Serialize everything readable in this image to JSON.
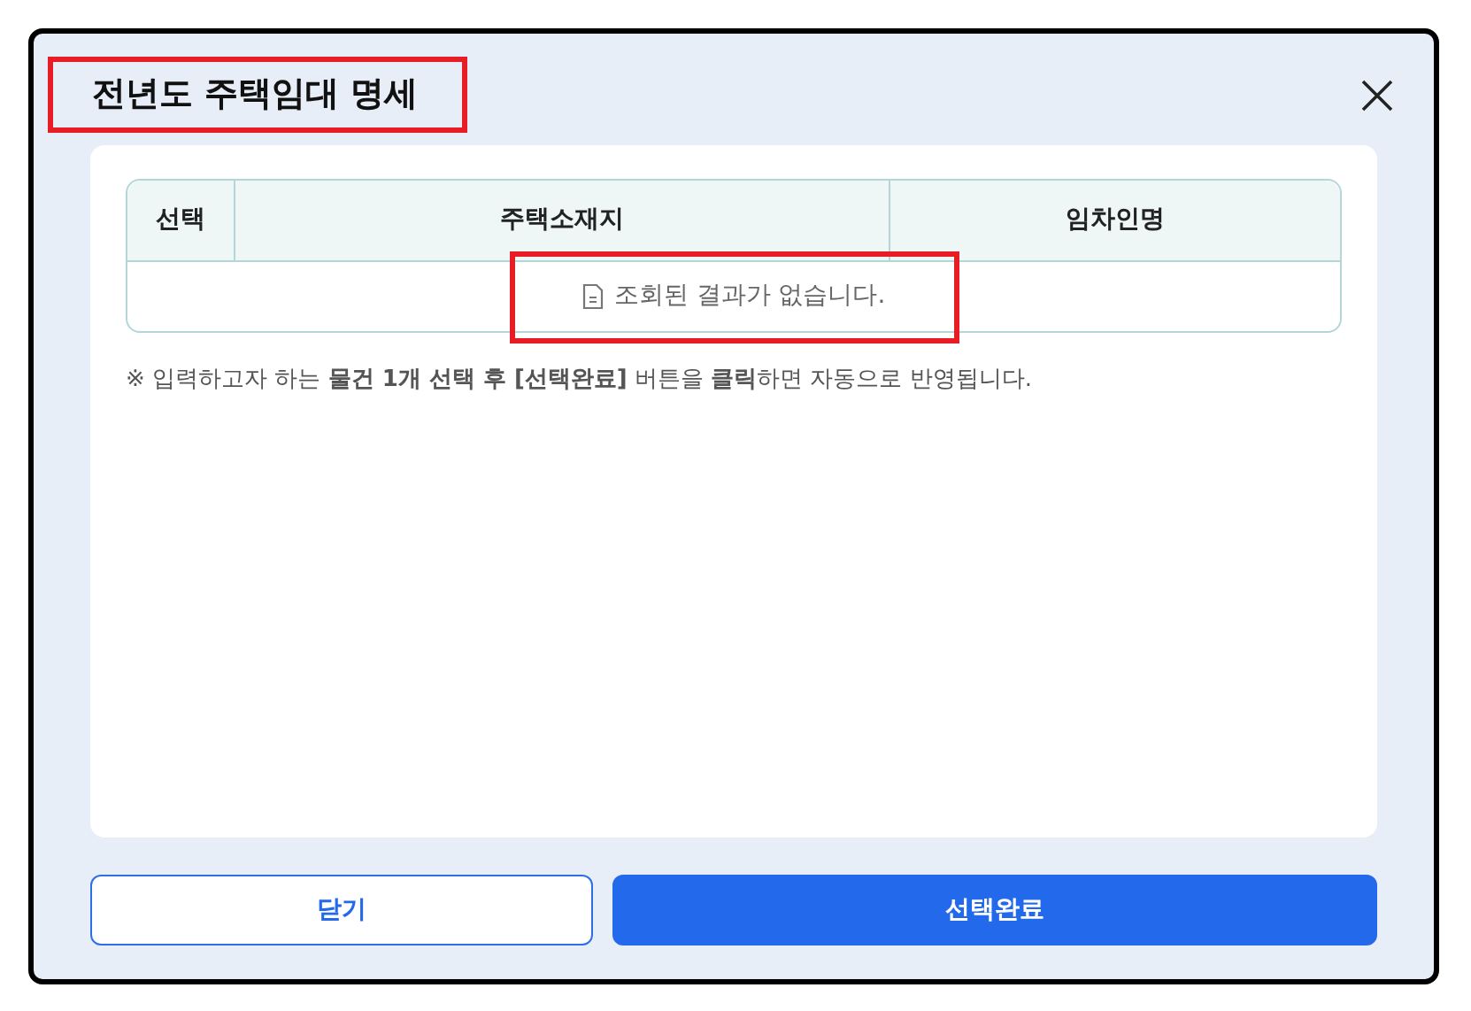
{
  "dialog": {
    "title": "전년도 주택임대 명세",
    "title_highlighted": true
  },
  "table": {
    "columns": [
      "선택",
      "주택소재지",
      "임차인명"
    ],
    "empty_message": "조회된 결과가 없습니다.",
    "empty_highlighted": true
  },
  "note": "※ 입력하고자 하는 **물건 1개 선택 후 [선택완료]** 버튼을 **클릭**하면 자동으로 반영됩니다.",
  "buttons": [
    {
      "label": "닫기",
      "kind": "secondary"
    },
    {
      "label": "선택완료",
      "kind": "primary"
    }
  ]
}
